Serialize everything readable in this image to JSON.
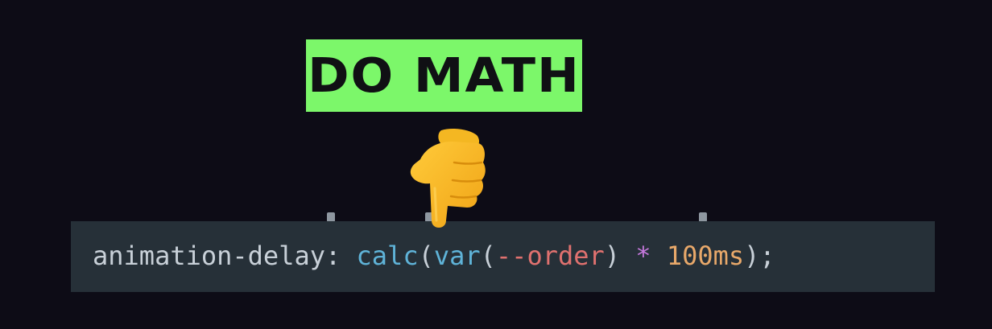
{
  "caption": {
    "text": "DO MATH",
    "background_color": "#7cf76a",
    "text_color": "#101014"
  },
  "pointer": {
    "icon": "pointing-down-hand-icon",
    "color": "#f2b21a"
  },
  "code": {
    "tokens": {
      "property": "animation-delay",
      "colon": ": ",
      "fn_calc": "calc",
      "open1": "(",
      "fn_var": "var",
      "open2": "(",
      "custom_prop": "--order",
      "close2": ")",
      "space1": " ",
      "operator": "*",
      "space2": " ",
      "number": "100ms",
      "close1": ")",
      "semicolon": ";"
    },
    "colors": {
      "background": "#263038",
      "page_background": "#0d0c16",
      "property": "#c8d0d8",
      "function": "#5fb3d8",
      "variable": "#e0716f",
      "operator": "#c679dd",
      "number": "#e8a86a"
    }
  }
}
